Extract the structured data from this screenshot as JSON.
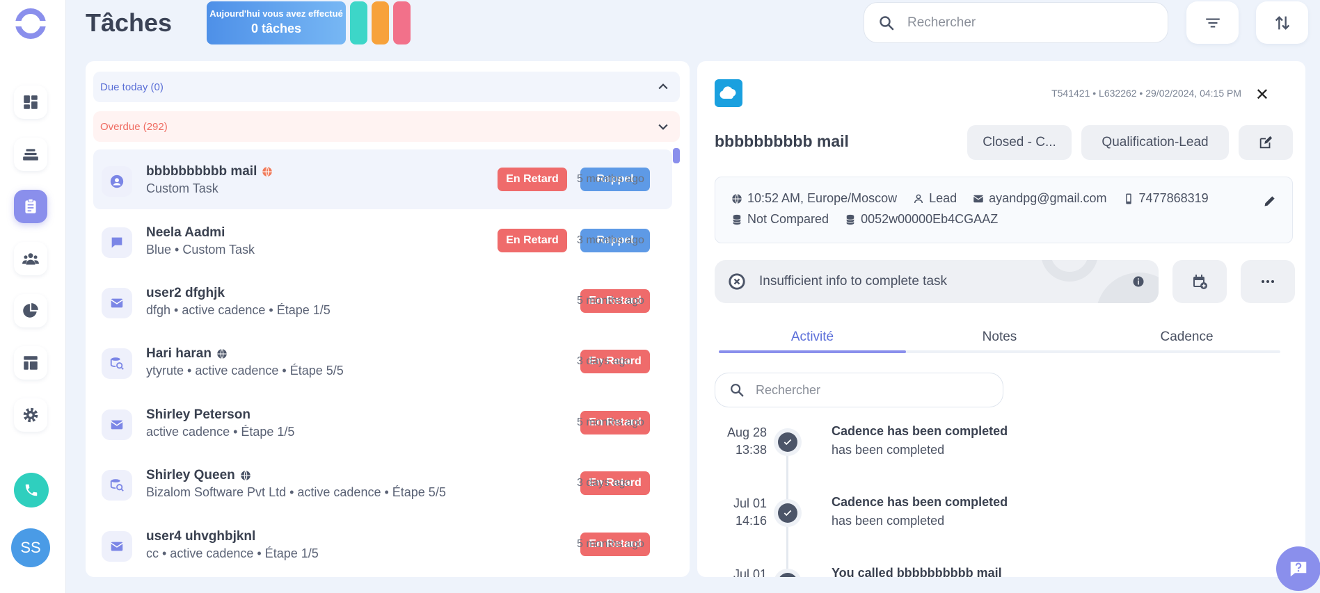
{
  "header": {
    "title": "Tâches",
    "today_line1": "Aujourd'hui vous avez effectué",
    "today_line2": "0 tâches",
    "search_placeholder": "Rechercher"
  },
  "colors": {
    "accent": "#8a8fec",
    "late": "#ef6b6b",
    "reminder": "#5e9ae6",
    "pill1": "#3dd6c8",
    "pill2": "#f7a23b",
    "pill3": "#f2718a"
  },
  "sidebar": {
    "items": [
      {
        "name": "dashboard-icon"
      },
      {
        "name": "stack-icon"
      },
      {
        "name": "clipboard-icon",
        "active": true
      },
      {
        "name": "people-icon"
      },
      {
        "name": "pie-chart-icon"
      },
      {
        "name": "layout-icon"
      },
      {
        "name": "gear-icon"
      }
    ],
    "avatar": "SS"
  },
  "groups": {
    "due_label": "Due today (0)",
    "overdue_label": "Overdue (292)"
  },
  "tasks": [
    {
      "name": "bbbbbbbbbb mail",
      "sub": "Custom Task",
      "late": "En Retard",
      "reminder": "Rappel",
      "ago": "5 months ago",
      "icon": "user-icon"
    },
    {
      "name": "Neela Aadmi",
      "sub": "Blue • Custom Task",
      "late": "En Retard",
      "reminder": "Rappel",
      "ago": "3 months ago",
      "icon": "chat-icon"
    },
    {
      "name": "user2 dfghjk",
      "sub": "dfgh • active cadence • Étape 1/5",
      "late": "En Retard",
      "ago": "5 months ago",
      "icon": "mail-icon"
    },
    {
      "name": "Hari haran",
      "sub": "ytyrute • active cadence • Étape 5/5",
      "late": "En Retard",
      "ago": "3 days ago",
      "icon": "research-icon"
    },
    {
      "name": "Shirley Peterson",
      "sub": "active cadence • Étape 1/5",
      "late": "En Retard",
      "ago": "5 months ago",
      "icon": "mail-icon"
    },
    {
      "name": "Shirley Queen",
      "sub": "Bizalom Software Pvt Ltd • active cadence • Étape 5/5",
      "late": "En Retard",
      "ago": "3 days ago",
      "icon": "research-icon"
    },
    {
      "name": "user4 uhvghbjknl",
      "sub": "cc • active cadence • Étape 1/5",
      "late": "En Retard",
      "ago": "5 months ago",
      "icon": "mail-icon"
    }
  ],
  "detail": {
    "ids": "T541421 • L632262 • 29/02/2024, 04:15 PM",
    "name": "bbbbbbbbbb mail",
    "status_chip": "Closed - C...",
    "stage_chip": "Qualification-Lead",
    "time": "10:52 AM, Europe/Moscow",
    "type": "Lead",
    "email": "ayandpg@gmail.com",
    "phone": "7477868319",
    "compare": "Not Compared",
    "sf_id": "0052w00000Eb4CGAAZ",
    "status_text": "Insufficient info to complete task",
    "tabs": [
      "Activité",
      "Notes",
      "Cadence"
    ],
    "activity_search_placeholder": "Rechercher",
    "activities": [
      {
        "date": "Aug 28",
        "time": "13:38",
        "title": "Cadence has been completed",
        "sub": "has been completed"
      },
      {
        "date": "Jul 01",
        "time": "14:16",
        "title": "Cadence has been completed",
        "sub": "has been completed"
      },
      {
        "date": "Jul 01",
        "time": "",
        "title": "You called bbbbbbbbbb mail",
        "sub": ""
      }
    ]
  }
}
